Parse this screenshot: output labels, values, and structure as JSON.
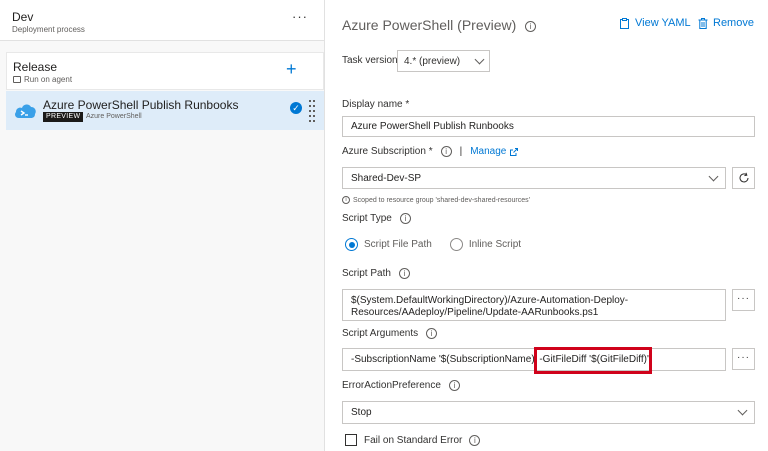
{
  "stage": {
    "name": "Dev",
    "subtitle": "Deployment process",
    "more": "···"
  },
  "job": {
    "name": "Release",
    "subtitle": "Run on agent",
    "add": "+"
  },
  "task": {
    "name": "Azure PowerShell Publish Runbooks",
    "badge": "PREVIEW",
    "type": "Azure PowerShell"
  },
  "header": {
    "title": "Azure PowerShell (Preview)",
    "view_yaml": "View YAML",
    "remove": "Remove"
  },
  "task_version": {
    "label": "Task version",
    "value": "4.* (preview)"
  },
  "display_name": {
    "label": "Display name *",
    "value": "Azure PowerShell Publish Runbooks"
  },
  "subscription": {
    "label": "Azure Subscription *",
    "manage": "Manage",
    "value": "Shared-Dev-SP",
    "hint": "Scoped to resource group 'shared-dev-shared-resources'"
  },
  "script_type": {
    "label": "Script Type",
    "options": [
      "Script File Path",
      "Inline Script"
    ],
    "selected": "Script File Path"
  },
  "script_path": {
    "label": "Script Path",
    "line1": "$(System.DefaultWorkingDirectory)/Azure-Automation-Deploy-",
    "line2": "Resources/AAdeploy/Pipeline/Update-AARunbooks.ps1"
  },
  "script_arguments": {
    "label": "Script Arguments",
    "value": "-SubscriptionName '$(SubscriptionName)' -GitFileDiff '$(GitFileDiff)'"
  },
  "error_action": {
    "label": "ErrorActionPreference",
    "value": "Stop"
  },
  "fail_on_stderr": {
    "label": "Fail on Standard Error",
    "checked": false
  },
  "colors": {
    "accent": "#0078d4",
    "highlight": "#d0021b",
    "selected_row": "#deecf9"
  }
}
